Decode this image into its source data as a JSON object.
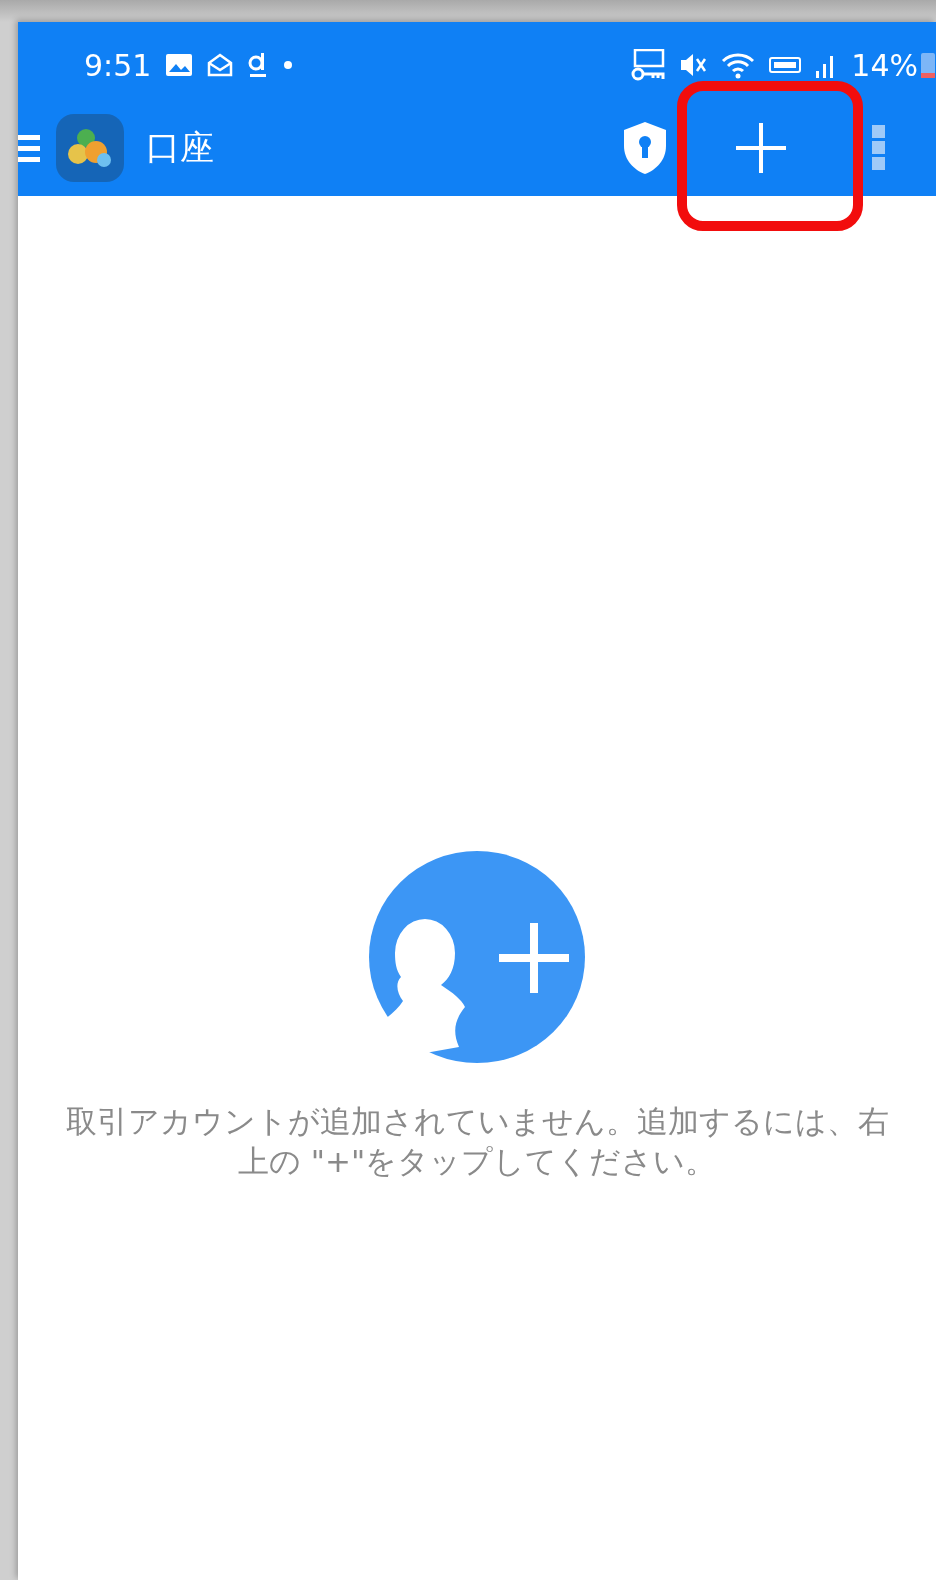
{
  "status_bar": {
    "time": "9:51",
    "battery": "14%"
  },
  "toolbar": {
    "title": "口座",
    "add_button": {
      "highlighted": true
    }
  },
  "empty_state": {
    "message": "取引アカウントが追加されていません。追加するには、右上の \"+\"をタップしてください。"
  }
}
